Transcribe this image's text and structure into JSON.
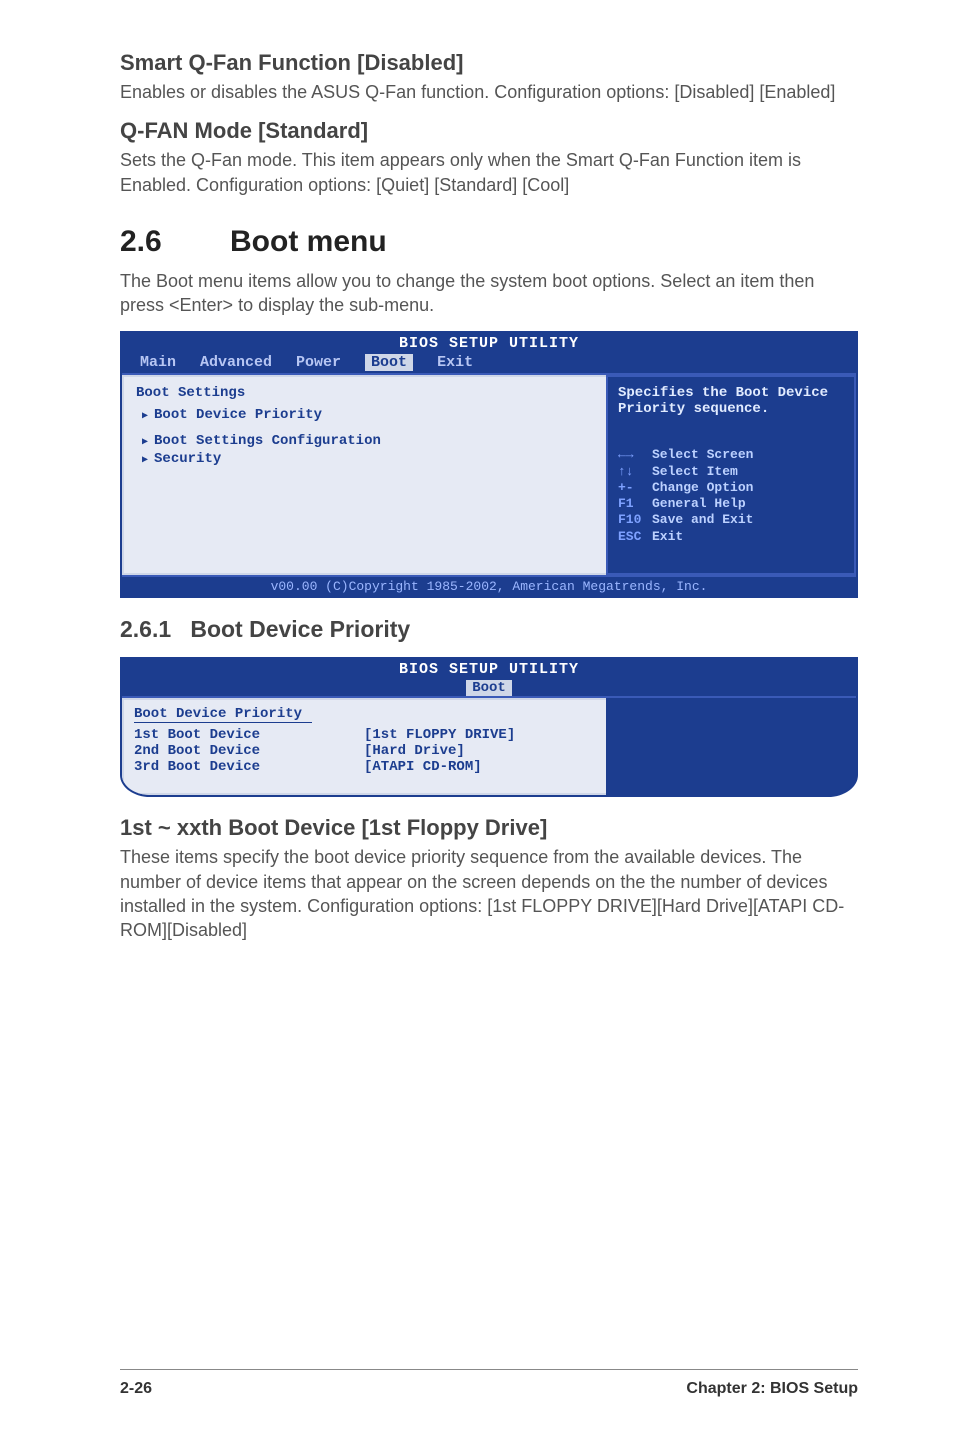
{
  "sect1": {
    "heading": "Smart Q-Fan Function [Disabled]",
    "body": "Enables or disables the ASUS Q-Fan function. Configuration options: [Disabled] [Enabled]"
  },
  "sect2": {
    "heading": "Q-FAN Mode [Standard]",
    "body": "Sets the Q-Fan mode. This item appears only when the Smart Q-Fan Function item is Enabled. Configuration options: [Quiet] [Standard] [Cool]"
  },
  "chapter": {
    "num": "2.6",
    "title": "Boot menu",
    "intro": "The Boot menu items allow you to change the system boot options. Select an item then press <Enter> to display the sub-menu."
  },
  "bios1": {
    "title": "BIOS SETUP UTILITY",
    "tabs": {
      "main": "Main",
      "advanced": "Advanced",
      "power": "Power",
      "boot": "Boot",
      "exit": "Exit"
    },
    "panel_title": "Boot Settings",
    "items": [
      "Boot Device Priority",
      "Boot Settings Configuration",
      "Security"
    ],
    "help": "Specifies the Boot Device Priority sequence.",
    "keys": [
      {
        "k": "←→",
        "d": "Select Screen"
      },
      {
        "k": "↑↓",
        "d": "Select Item"
      },
      {
        "k": "+-",
        "d": "Change Option"
      },
      {
        "k": "F1",
        "d": "General Help"
      },
      {
        "k": "F10",
        "d": "Save and Exit"
      },
      {
        "k": "ESC",
        "d": "Exit"
      }
    ],
    "footer": "v00.00 (C)Copyright 1985-2002, American Megatrends, Inc."
  },
  "sub": {
    "num": "2.6.1",
    "title": "Boot Device Priority"
  },
  "bios2": {
    "title": "BIOS SETUP UTILITY",
    "tab": "Boot",
    "panel_title": "Boot Device Priority",
    "rows": [
      {
        "label": "1st Boot Device",
        "val": "[1st FLOPPY DRIVE]"
      },
      {
        "label": "2nd Boot Device",
        "val": "[Hard Drive]"
      },
      {
        "label": "3rd Boot Device",
        "val": "[ATAPI CD-ROM]"
      }
    ]
  },
  "sect3": {
    "heading": "1st ~ xxth Boot Device [1st Floppy Drive]",
    "body": "These items specify the boot device priority sequence from the available devices. The number of device items that appear on the screen depends on the the number of devices installed in the system. Configuration options: [1st FLOPPY DRIVE][Hard Drive][ATAPI CD-ROM][Disabled]"
  },
  "footer": {
    "left": "2-26",
    "right": "Chapter 2: BIOS Setup"
  }
}
